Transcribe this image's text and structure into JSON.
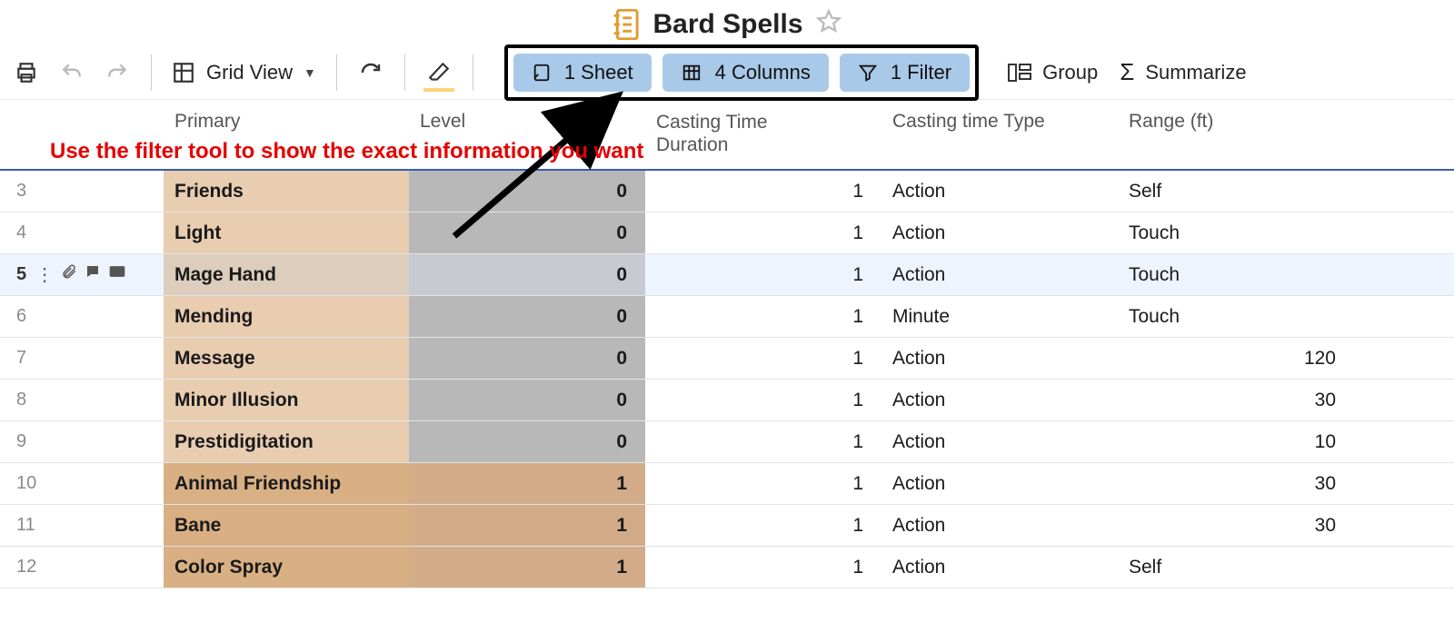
{
  "title": "Bard Spells",
  "toolbar": {
    "grid_view": "Grid View",
    "sheet": "1 Sheet",
    "columns": "4 Columns",
    "filter": "1 Filter",
    "group": "Group",
    "summarize": "Summarize"
  },
  "annotation": "Use the filter tool to show the exact information you want",
  "columns": {
    "primary": "Primary",
    "level": "Level",
    "casting_duration_a": "Casting Time",
    "casting_duration_b": "Duration",
    "casting_type": "Casting time Type",
    "range": "Range (ft)"
  },
  "rows": [
    {
      "n": "3",
      "primary": "Friends",
      "level": "0",
      "cast": "1",
      "type": "Action",
      "range": "Self",
      "lvl": 0
    },
    {
      "n": "4",
      "primary": "Light",
      "level": "0",
      "cast": "1",
      "type": "Action",
      "range": "Touch",
      "lvl": 0
    },
    {
      "n": "5",
      "primary": "Mage Hand",
      "level": "0",
      "cast": "1",
      "type": "Action",
      "range": "Touch",
      "lvl": 0,
      "hover": true
    },
    {
      "n": "6",
      "primary": "Mending",
      "level": "0",
      "cast": "1",
      "type": "Minute",
      "range": "Touch",
      "lvl": 0
    },
    {
      "n": "7",
      "primary": "Message",
      "level": "0",
      "cast": "1",
      "type": "Action",
      "range": "120",
      "lvl": 0,
      "rnum": true
    },
    {
      "n": "8",
      "primary": "Minor Illusion",
      "level": "0",
      "cast": "1",
      "type": "Action",
      "range": "30",
      "lvl": 0,
      "rnum": true
    },
    {
      "n": "9",
      "primary": "Prestidigitation",
      "level": "0",
      "cast": "1",
      "type": "Action",
      "range": "10",
      "lvl": 0,
      "rnum": true
    },
    {
      "n": "10",
      "primary": "Animal Friendship",
      "level": "1",
      "cast": "1",
      "type": "Action",
      "range": "30",
      "lvl": 1,
      "rnum": true
    },
    {
      "n": "11",
      "primary": "Bane",
      "level": "1",
      "cast": "1",
      "type": "Action",
      "range": "30",
      "lvl": 1,
      "rnum": true
    },
    {
      "n": "12",
      "primary": "Color Spray",
      "level": "1",
      "cast": "1",
      "type": "Action",
      "range": "Self",
      "lvl": 1
    }
  ]
}
